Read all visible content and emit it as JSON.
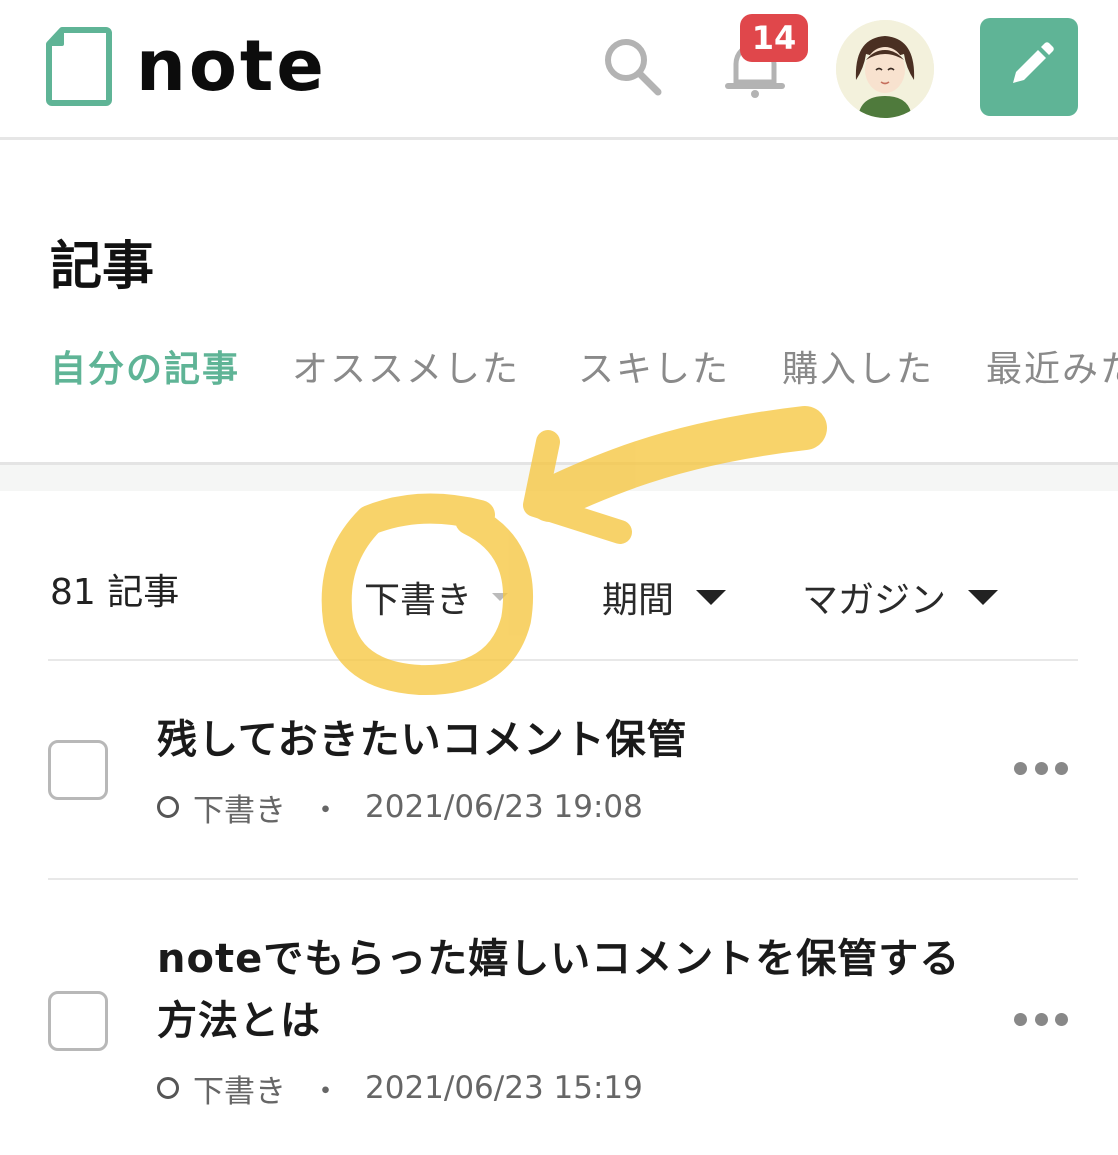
{
  "header": {
    "logo_text": "note",
    "notification_count": "14",
    "icons": {
      "logo": "note-logo-icon",
      "search": "search-icon",
      "bell": "bell-icon",
      "post": "pencil-icon",
      "avatar": "user-avatar"
    },
    "colors": {
      "brand": "#5fb496",
      "badge": "#e0474b"
    }
  },
  "page": {
    "title": "記事"
  },
  "tabs": [
    {
      "label": "自分の記事",
      "active": true
    },
    {
      "label": "オススメした",
      "active": false
    },
    {
      "label": "スキした",
      "active": false
    },
    {
      "label": "購入した",
      "active": false
    },
    {
      "label": "最近みた",
      "active": false
    }
  ],
  "filters": {
    "count": "81 記事",
    "status": "下書き",
    "period": "期間",
    "magazine": "マガジン"
  },
  "articles": [
    {
      "title_lines": [
        "残しておきたいコメント保管"
      ],
      "status": "下書き",
      "sep": "・",
      "datetime": "2021/06/23 19:08"
    },
    {
      "title_lines": [
        "noteでもらった嬉しいコメントを保管する",
        "方法とは"
      ],
      "status": "下書き",
      "sep": "・",
      "datetime": "2021/06/23 15:19"
    }
  ],
  "annotation": {
    "color": "#f6c640",
    "shapes": [
      "highlighter-circle",
      "highlighter-arrow"
    ]
  }
}
